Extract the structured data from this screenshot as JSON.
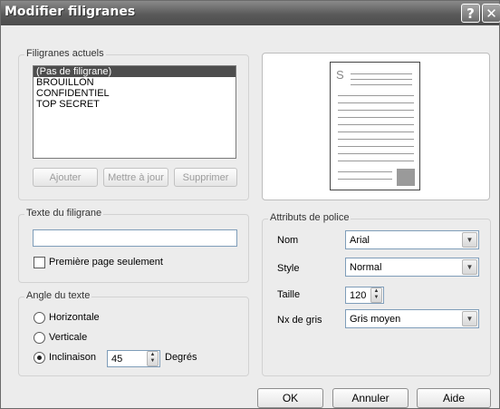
{
  "window": {
    "title": "Modifier filigranes"
  },
  "current": {
    "label": "Filigranes actuels",
    "items": [
      "(Pas de filigrane)",
      "BROUILLON",
      "CONFIDENTIEL",
      "TOP SECRET"
    ],
    "selected_index": 0,
    "buttons": {
      "add": "Ajouter",
      "update": "Mettre à jour",
      "delete": "Supprimer"
    }
  },
  "preview": {
    "letter": "S"
  },
  "text_group": {
    "label": "Texte du filigrane",
    "value": "",
    "first_page_label": "Première page seulement",
    "first_page_checked": false
  },
  "angle_group": {
    "label": "Angle du texte",
    "horizontal": "Horizontale",
    "vertical": "Verticale",
    "inclinaison": "Inclinaison",
    "inclinaison_value": "45",
    "unit": "Degrés",
    "selected": "inclinaison"
  },
  "font_group": {
    "label": "Attributs de police",
    "name_label": "Nom",
    "name_value": "Arial",
    "style_label": "Style",
    "style_value": "Normal",
    "size_label": "Taille",
    "size_value": "120",
    "gray_label": "Nx de gris",
    "gray_value": "Gris moyen"
  },
  "footer": {
    "ok": "OK",
    "cancel": "Annuler",
    "help": "Aide"
  },
  "colors": {
    "titlebar": "#5a5a5a",
    "selection": "#4d4d4d",
    "preview_square": "#9a9a9a"
  }
}
